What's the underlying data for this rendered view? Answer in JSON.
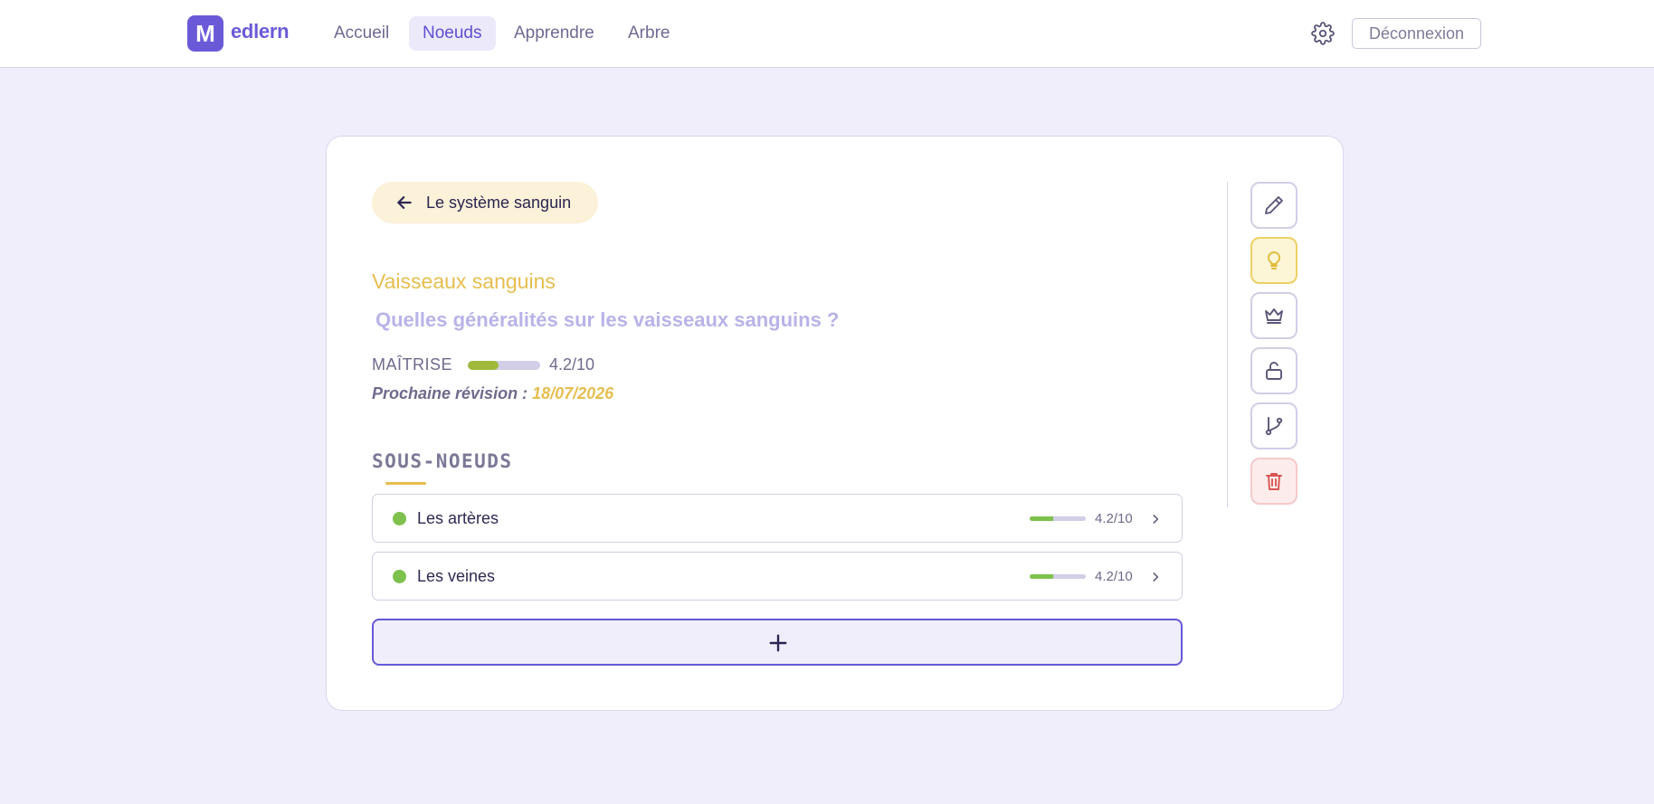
{
  "app": {
    "logo_letter": "M",
    "logo_text": "edlern",
    "nav": [
      {
        "label": "Accueil",
        "active": false
      },
      {
        "label": "Noeuds",
        "active": true
      },
      {
        "label": "Apprendre",
        "active": false
      },
      {
        "label": "Arbre",
        "active": false
      }
    ],
    "settings_icon": "gear-icon",
    "logout_label": "Déconnexion"
  },
  "node": {
    "back_label": "Le système sanguin",
    "title": "Vaisseaux sanguins",
    "question": "Quelles généralités sur les vaisseaux sanguins ?",
    "mastery_label": "MAÎTRISE",
    "mastery_fraction": 0.42,
    "mastery_score": "4.2/10",
    "next_review_label": "Prochaine révision :",
    "next_review_date": "18/07/2026"
  },
  "subnodes": {
    "title": "SOUS-NOEUDS",
    "items": [
      {
        "label": "Les artères",
        "mastery_fraction": 0.42,
        "score": "4.2/10"
      },
      {
        "label": "Les veines",
        "mastery_fraction": 0.42,
        "score": "4.2/10"
      }
    ],
    "add_icon": "plus-icon"
  },
  "tools": [
    {
      "name": "edit-icon"
    },
    {
      "name": "lightbulb-icon"
    },
    {
      "name": "crown-icon"
    },
    {
      "name": "unlock-icon"
    },
    {
      "name": "branch-icon"
    },
    {
      "name": "trash-icon"
    }
  ],
  "colors": {
    "brand": "#6a5ad8",
    "accent_yellow": "#e6be4f",
    "mastery_green": "#9fba3a",
    "status_green": "#7ec14d",
    "danger": "#d95454"
  }
}
